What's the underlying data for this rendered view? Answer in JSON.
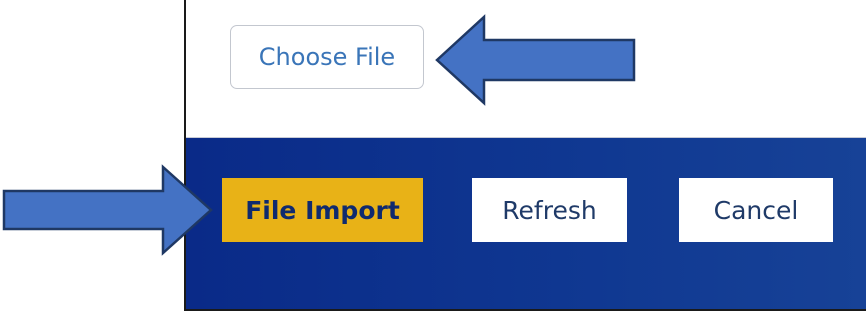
{
  "upload": {
    "choose_file_label": "Choose File"
  },
  "actions": {
    "file_import_label": "File Import",
    "refresh_label": "Refresh",
    "cancel_label": "Cancel"
  },
  "colors": {
    "footer_bar": "#0f3791",
    "primary_button": "#e8b217",
    "annotation_arrow": "#4472c4"
  },
  "annotations": {
    "arrows": [
      "arrow-icon",
      "arrow-icon"
    ]
  }
}
